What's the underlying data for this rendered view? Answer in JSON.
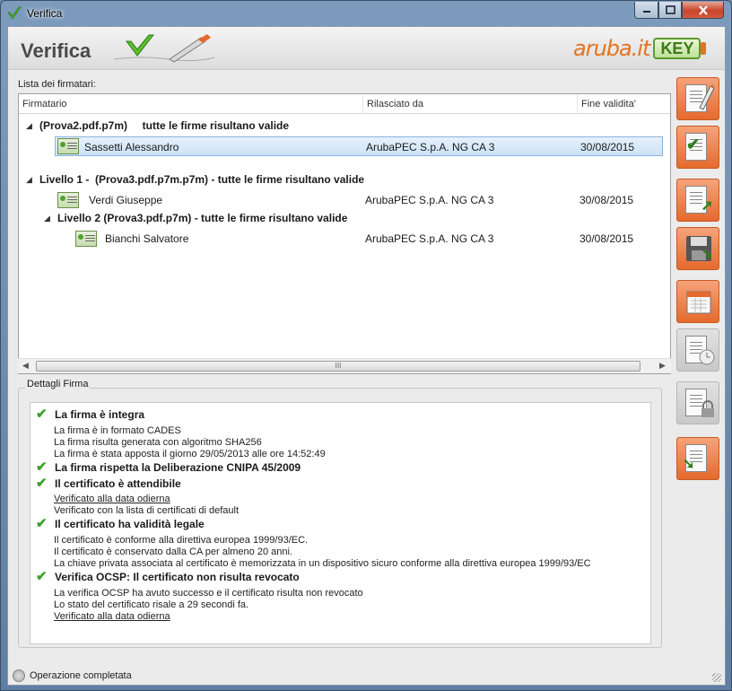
{
  "window": {
    "title": "Verifica"
  },
  "header": {
    "title": "Verifica",
    "brand_name": "aruba.it",
    "brand_key": "KEY"
  },
  "list": {
    "label": "Lista dei firmatari:",
    "columns": [
      "Firmatario",
      "Rilasciato da",
      "Fine validita'"
    ],
    "groups": [
      {
        "title": "(Prova2.pdf.p7m)     tutte le firme risultano valide",
        "expander": "◢"
      },
      {
        "title": "Livello 1 -  (Prova3.pdf.p7m.p7m) - tutte le firme risultano valide",
        "expander": "◢"
      },
      {
        "title": "Livello 2 (Prova3.pdf.p7m) - tutte le firme risultano valide",
        "expander": "◢"
      }
    ],
    "signers": [
      {
        "name": "Sassetti Alessandro",
        "issuer": "ArubaPEC S.p.A. NG CA 3",
        "expiry": "30/08/2015"
      },
      {
        "name": "Verdi Giuseppe",
        "issuer": "ArubaPEC S.p.A. NG CA 3",
        "expiry": "30/08/2015"
      },
      {
        "name": "Bianchi Salvatore",
        "issuer": "ArubaPEC S.p.A. NG CA 3",
        "expiry": "30/08/2015"
      }
    ]
  },
  "details": {
    "title": "Dettagli Firma",
    "checks": [
      "La firma è integra",
      "La firma rispetta la Deliberazione CNIPA 45/2009",
      "Il certificato è attendibile",
      "Il certificato ha validità legale",
      "Verifica OCSP: Il certificato non risulta revocato"
    ],
    "lines": [
      "La firma è in formato CADES",
      "La firma risulta generata con algoritmo SHA256",
      "La firma è stata apposta il giorno 29/05/2013 alle ore 14:52:49",
      "Verificato alla data odierna",
      "Verificato con la lista di certificati di default",
      "Il certificato è conforme alla direttiva europea 1999/93/EC.",
      "Il certificato è conservato dalla CA per almeno 20 anni.",
      "La chiave privata associata al certificato è memorizzata in un dispositivo sicuro conforme alla direttiva europea 1999/93/EC",
      "La verifica OCSP ha avuto successo e il certificato risulta non revocato",
      "Lo stato del certificato risale a 29 secondi fa.",
      "Verificato alla data odierna"
    ]
  },
  "toolbar": {
    "buttons": [
      "sign-document",
      "verify-document",
      "export-document",
      "save-document",
      "timestamp-calendar",
      "certificate-disabled",
      "lock-disabled",
      "extract-document"
    ]
  },
  "status": {
    "text": "Operazione completata"
  },
  "scrollbar": {
    "grip": "III"
  },
  "colors": {
    "accent": "#e56a2d",
    "check": "#3ba02c",
    "selection": "#cde3f7"
  }
}
